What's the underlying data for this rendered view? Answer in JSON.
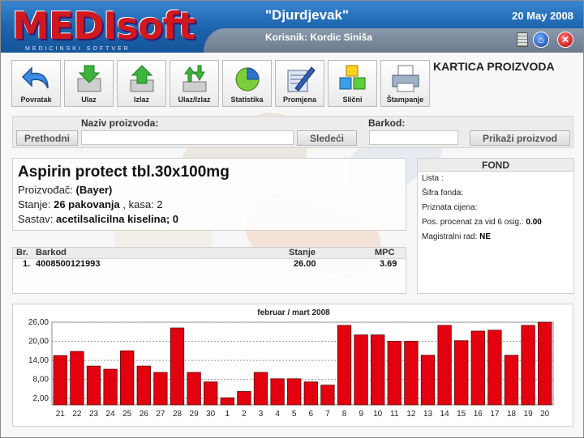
{
  "header": {
    "logo_text": "MEDIsoft",
    "logo_subtitle": "MEDICINSKI SOFTVER",
    "pharmacy_name": "\"Djurdjevak\"",
    "date": "20 May 2008",
    "user_line": "Korisnik: Kordic Siniša",
    "icons": [
      "calculator-icon",
      "home-icon",
      "close-icon"
    ]
  },
  "toolbar": {
    "buttons": [
      {
        "label": "Povratak",
        "icon": "back-arrow-icon"
      },
      {
        "label": "Ulaz",
        "icon": "box-in-icon"
      },
      {
        "label": "Izlaz",
        "icon": "box-out-icon"
      },
      {
        "label": "Ulaz/Izlaz",
        "icon": "box-in-out-icon"
      },
      {
        "label": "Statistika",
        "icon": "pie-chart-icon"
      },
      {
        "label": "Promjena",
        "icon": "edit-icon"
      },
      {
        "label": "Slični",
        "icon": "cubes-icon"
      },
      {
        "label": "Štampanje",
        "icon": "printer-icon"
      }
    ]
  },
  "page_title": "KARTICA PROIZVODA",
  "search": {
    "name_label": "Naziv proizvoda:",
    "barcode_label": "Barkod:",
    "prev_button": "Prethodni",
    "next_button": "Sledeći",
    "show_button": "Prikaži proizvod",
    "name_value": "",
    "barcode_value": ""
  },
  "product": {
    "name": "Aspirin protect tbl.30x100mg",
    "manufacturer_label": "Proizvođač:",
    "manufacturer": "(Bayer)",
    "stock_label": "Stanje:",
    "stock": "26 pakovanja",
    "kasa_label": ", kasa:",
    "kasa": "2",
    "composition_label": "Sastav:",
    "composition": "acetilsalicilna kiselina; 0"
  },
  "fond": {
    "title": "FOND",
    "lista_label": "Lista :",
    "sifra_label": "Šifra fonda:",
    "priznata_label": "Priznata cijena:",
    "pos_label": "Pos. procenat za vid 6 osig.:",
    "pos_value": "0.00",
    "magistralni_label": "Magistralni rad:",
    "magistralni_value": "NE"
  },
  "barcodes": {
    "headers": {
      "br": "Br.",
      "barkod": "Barkod",
      "stanje": "Stanje",
      "mpc": "MPC"
    },
    "rows": [
      {
        "br": "1.",
        "barkod": "4008500121993",
        "stanje": "26.00",
        "mpc": "3.69"
      }
    ]
  },
  "chart_data": {
    "type": "bar",
    "title": "februar / mart 2008",
    "xlabel": "",
    "ylabel": "",
    "categories": [
      "21",
      "22",
      "23",
      "24",
      "25",
      "26",
      "27",
      "28",
      "29",
      "30",
      "1",
      "2",
      "3",
      "4",
      "5",
      "6",
      "7",
      "8",
      "9",
      "10",
      "11",
      "12",
      "13",
      "14",
      "15",
      "16",
      "17",
      "18",
      "19",
      "20"
    ],
    "values": [
      15.5,
      16.8,
      12.2,
      11.2,
      17.0,
      12.2,
      10.2,
      24.2,
      10.2,
      7.2,
      2.2,
      4.2,
      10.2,
      8.2,
      8.2,
      7.2,
      6.2,
      25.0,
      22.0,
      22.0,
      20.0,
      20.0,
      15.6,
      25.0,
      20.2,
      23.2,
      23.5,
      15.6,
      25.0,
      26.0
    ],
    "ylim": [
      0,
      26
    ],
    "yticks": [
      "26,00",
      "20,00",
      "14,00",
      "8,00",
      "2,00"
    ],
    "ytick_values": [
      26,
      20,
      14,
      8,
      2
    ],
    "bar_color": "#e3000f",
    "grid": true
  }
}
